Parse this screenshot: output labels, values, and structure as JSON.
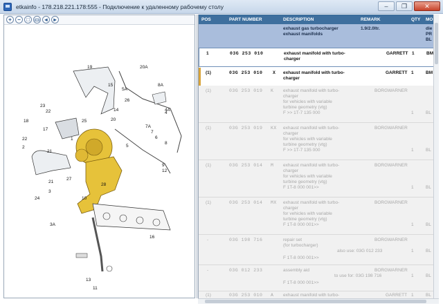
{
  "window": {
    "title": "etkainfo - 178.218.221.178:555 - Подключение к удаленному рабочему столу",
    "minimize": "–",
    "restore": "❐",
    "close": "✕"
  },
  "toolbar": {
    "zoom_in": "+",
    "zoom_out": "−",
    "zoom_fit": "□",
    "zoom_sel": "▭",
    "zoom_prev": "◂",
    "zoom_next": "▸"
  },
  "diagram": {
    "labels": [
      "19",
      "20A",
      "8A",
      "15",
      "5A",
      "23",
      "22",
      "18",
      "25",
      "17",
      "22",
      "1",
      "2",
      "21",
      "21",
      "26",
      "20",
      "4",
      "14",
      "7A",
      "7",
      "6",
      "5",
      "9",
      "12",
      "10",
      "3",
      "24",
      "3A",
      "13",
      "11",
      "16",
      "4A",
      "8",
      "28",
      "27"
    ]
  },
  "table": {
    "columns": {
      "pos": "POS",
      "part": "PART NUMBER",
      "desc": "DESCRIPTION",
      "remark": "REMARK",
      "qty": "QTY",
      "model": "MO"
    },
    "group": {
      "desc1": "exhaust gas turbocharger",
      "desc2": "exhaust manifolds",
      "remark": "1.9/2.0ltr.",
      "model1": "die",
      "model2": "PR",
      "model3": "BL"
    },
    "rows": [
      {
        "pos": "1",
        "part": "03G  253  010",
        "suffix": "",
        "desc1": "exhaust manifold with turbo-",
        "desc2": "charger",
        "desc3": "",
        "desc4": "",
        "desc5": "",
        "remark": "GARRETT",
        "qty": "1",
        "model": "BM"
      },
      {
        "pos": "(1)",
        "part": "03G  253  010",
        "suffix": "X",
        "desc1": "exhaust manifold with turbo-",
        "desc2": "charger",
        "desc3": "",
        "desc4": "",
        "desc5": "",
        "remark": "GARRETT",
        "qty": "1",
        "model": "BM"
      },
      {
        "pos": "(1)",
        "part": "03G  253  019",
        "suffix": "K",
        "desc1": "exhaust manifold with turbo-",
        "desc2": "charger",
        "desc3": "for vehicles with variable",
        "desc4": "turbine geometry (vtg)",
        "desc5": "F              >> 1T-7 135 000",
        "remark": "BORGWARNER",
        "qty": "1",
        "model": "BL"
      },
      {
        "pos": "(1)",
        "part": "03G  253  019",
        "suffix": "KX",
        "desc1": "exhaust manifold with turbo-",
        "desc2": "charger",
        "desc3": "for vehicles with variable",
        "desc4": "turbine geometry (vtg)",
        "desc5": "F              >> 1T-7 135 000",
        "remark": "BORGWARNER",
        "qty": "1",
        "model": "BL"
      },
      {
        "pos": "(1)",
        "part": "03G  253  014",
        "suffix": "M",
        "desc1": "exhaust manifold with turbo-",
        "desc2": "charger",
        "desc3": "for vehicles with variable",
        "desc4": "turbine geometry (vtg)",
        "desc5": "F 1T-8 000 001>>",
        "remark": "BORGWARNER",
        "qty": "1",
        "model": "BL"
      },
      {
        "pos": "(1)",
        "part": "03G  253  014",
        "suffix": "MX",
        "desc1": "exhaust manifold with turbo-",
        "desc2": "charger",
        "desc3": "for vehicles with variable",
        "desc4": "turbine geometry (vtg)",
        "desc5": "F 1T-8 000 001>>",
        "remark": "BORGWARNER",
        "qty": "1",
        "model": "BL"
      },
      {
        "pos": "-",
        "part": "03G  198  716",
        "suffix": "",
        "desc1": "repair set",
        "desc2": "(for turbocharger)",
        "desc3": "also use:   03G 012 233",
        "desc4": "F 1T-8 000 001>>",
        "desc5": "",
        "remark": "BORGWARNER",
        "qty": "1",
        "model": "BL"
      },
      {
        "pos": "-",
        "part": "03G  012  233",
        "suffix": "",
        "desc1": "assembly aid",
        "desc2": "to use for:   03G 198 716",
        "desc3": "F 1T-8 000 001>>",
        "desc4": "",
        "desc5": "",
        "remark": "BORGWARNER",
        "qty": "1",
        "model": "BL"
      },
      {
        "pos": "(1)",
        "part": "03G  253  010",
        "suffix": "A",
        "desc1": "exhaust manifold with turbo-",
        "desc2": "",
        "desc3": "",
        "desc4": "",
        "desc5": "",
        "remark": "GARRETT",
        "qty": "1",
        "model": "BL"
      }
    ]
  }
}
